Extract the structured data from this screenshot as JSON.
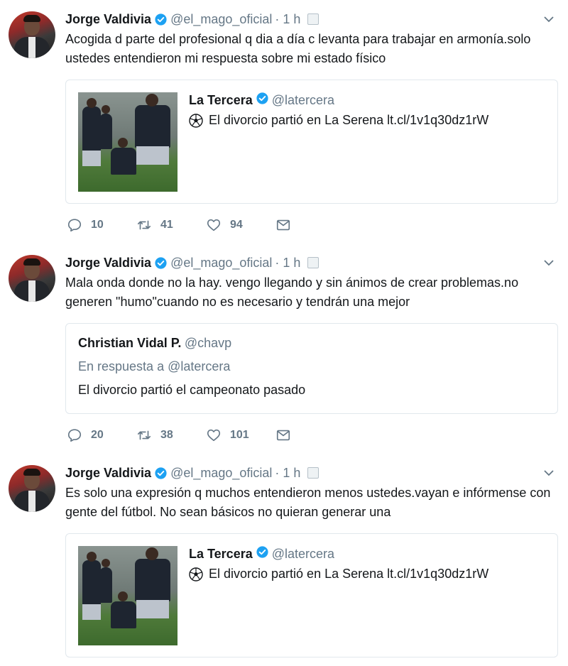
{
  "tweets": [
    {
      "author": "Jorge Valdivia",
      "handle": "@el_mago_oficial",
      "time": "· 1 h",
      "text": "Acogida d parte del profesional q dia a día c levanta para trabajar en armonía.solo ustedes entendieron mi respuesta sobre mi estado físico",
      "quoted": {
        "name": "La Tercera",
        "handle": "@latercera",
        "text": "El divorcio partió en La Serena lt.cl/1v1q30dz1rW"
      },
      "replies": "10",
      "retweets": "41",
      "likes": "94"
    },
    {
      "author": "Jorge Valdivia",
      "handle": "@el_mago_oficial",
      "time": "· 1 h",
      "text": "Mala onda donde no la hay. vengo llegando y sin ánimos de crear problemas.no generen \"humo\"cuando no es necesario y tendrán una mejor",
      "quoted": {
        "name": "Christian Vidal P.",
        "handle": "@chavp",
        "reply_to": "En respuesta a @latercera",
        "text": "El divorcio partió el campeonato pasado"
      },
      "replies": "20",
      "retweets": "38",
      "likes": "101"
    },
    {
      "author": "Jorge Valdivia",
      "handle": "@el_mago_oficial",
      "time": "· 1 h",
      "text": "Es solo una expresión q muchos entendieron menos ustedes.vayan e infórmense con gente del fútbol. No sean básicos no quieran generar una",
      "quoted": {
        "name": "La Tercera",
        "handle": "@latercera",
        "text": "El divorcio partió en La Serena lt.cl/1v1q30dz1rW"
      }
    }
  ],
  "colors": {
    "verified": "#1da1f2",
    "muted": "#657786",
    "text": "#14171a",
    "border": "#e1e8ed"
  }
}
